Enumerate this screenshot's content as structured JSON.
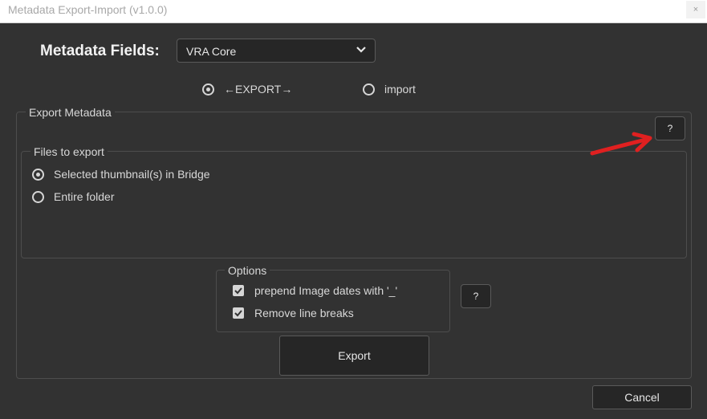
{
  "window": {
    "title": "Metadata Export-Import (v1.0.0)",
    "close_glyph": "×"
  },
  "fields": {
    "label": "Metadata Fields:",
    "selected": "VRA Core"
  },
  "mode": {
    "export_label": "←EXPORT→",
    "import_label": "import",
    "selected": "export"
  },
  "export_panel": {
    "legend": "Export Metadata",
    "help_label": "?"
  },
  "files_panel": {
    "legend": "Files to export",
    "options": [
      {
        "label": "Selected thumbnail(s) in Bridge",
        "selected": true
      },
      {
        "label": "Entire folder",
        "selected": false
      }
    ]
  },
  "options_panel": {
    "legend": "Options",
    "items": [
      {
        "label": "prepend Image dates with '_'",
        "checked": true
      },
      {
        "label": "Remove line breaks",
        "checked": true
      }
    ],
    "help_label": "?"
  },
  "buttons": {
    "export": "Export",
    "cancel": "Cancel"
  },
  "colors": {
    "background": "#323232",
    "control": "#262626",
    "border": "#5a5a5a",
    "annotation_arrow": "#e02020"
  }
}
